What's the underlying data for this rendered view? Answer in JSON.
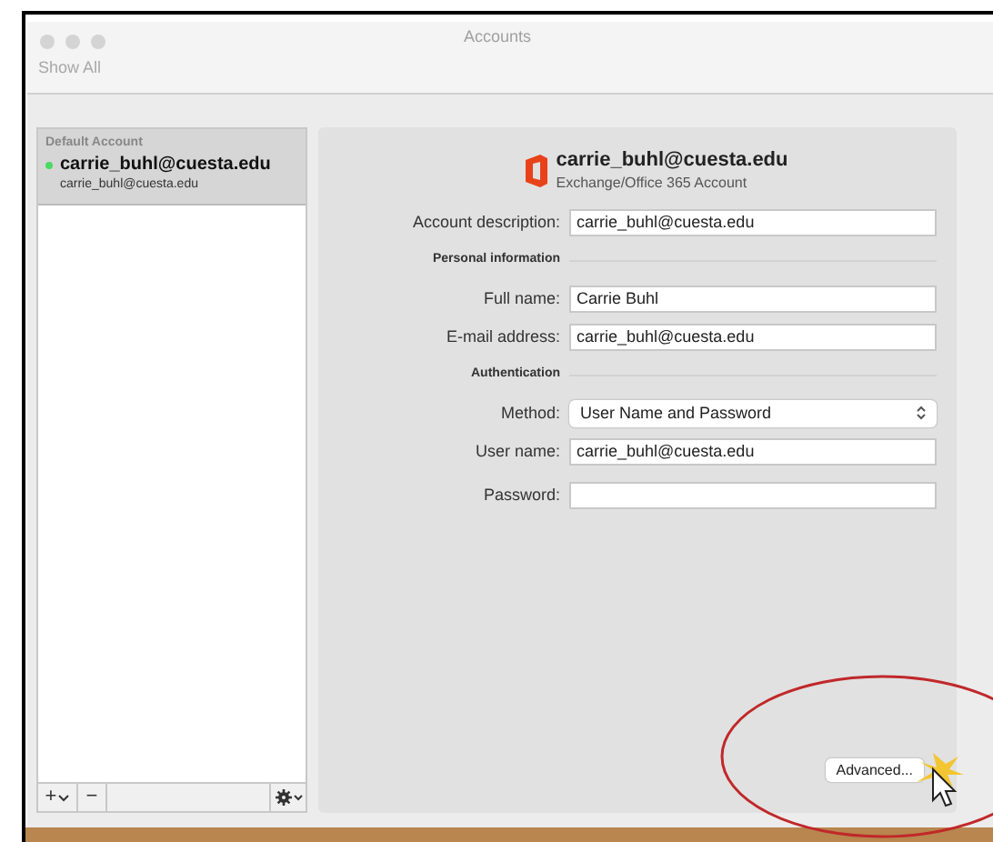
{
  "window": {
    "title": "Accounts"
  },
  "toolbar": {
    "show_all": "Show All"
  },
  "accounts": {
    "header": "Default Account",
    "items": [
      {
        "name": "carrie_buhl@cuesta.edu",
        "address": "carrie_buhl@cuesta.edu",
        "selected": true,
        "color": "#4cd964"
      }
    ]
  },
  "list_buttons": [
    "+",
    "−"
  ],
  "account": {
    "name": "carrie_buhl@cuesta.edu",
    "type": "Exchange/Office 365 Account"
  },
  "form": [
    {
      "kind": "field",
      "label": "Account description:",
      "value": "carrie_buhl@cuesta.edu"
    },
    {
      "kind": "section",
      "label": "Personal information"
    },
    {
      "kind": "field",
      "label": "Full name:",
      "value": "Carrie Buhl"
    },
    {
      "kind": "field",
      "label": "E-mail address:",
      "value": "carrie_buhl@cuesta.edu"
    },
    {
      "kind": "section",
      "label": "Authentication"
    },
    {
      "kind": "select",
      "label": "Method:",
      "value": "User Name and Password"
    },
    {
      "kind": "field",
      "label": "User name:",
      "value": "carrie_buhl@cuesta.edu"
    },
    {
      "kind": "password",
      "label": "Password:"
    }
  ],
  "advanced_button": "Advanced..."
}
